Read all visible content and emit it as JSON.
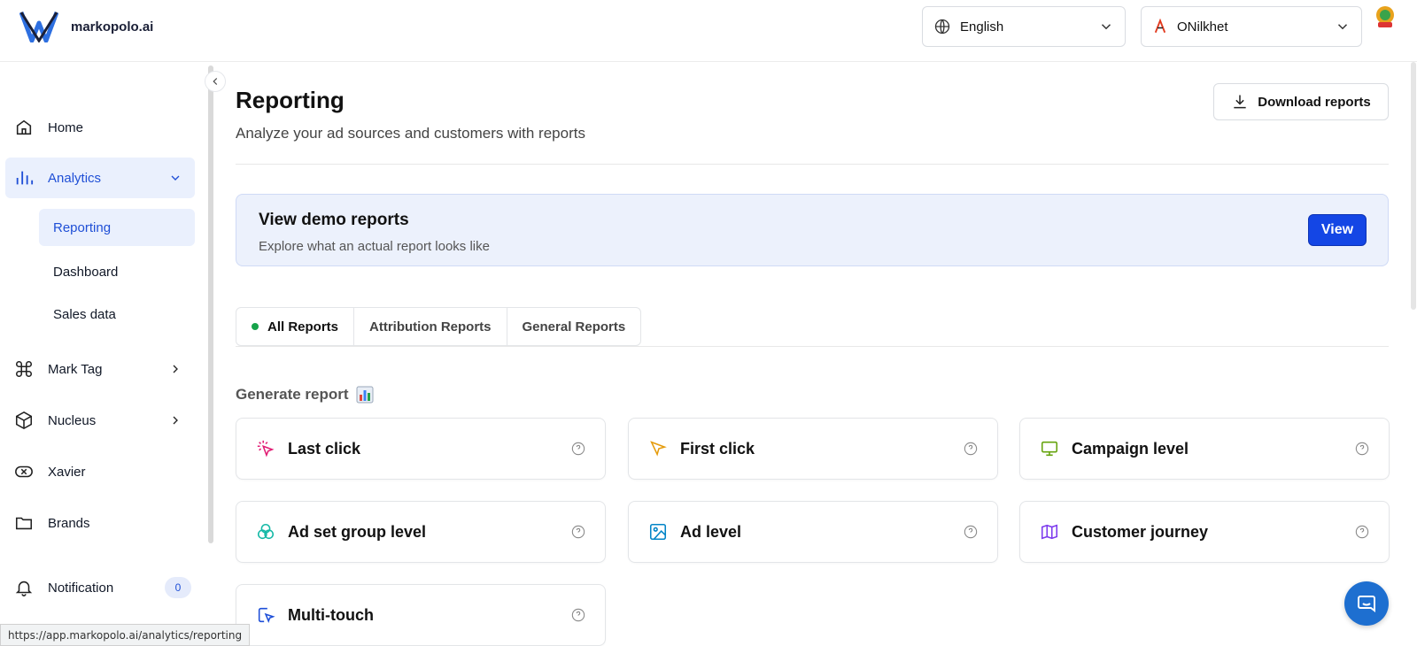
{
  "header": {
    "brand": "markopolo.ai",
    "language_select": "English",
    "account_select": "ONilkhet"
  },
  "sidebar": {
    "items": [
      {
        "label": "Home",
        "icon": "home-icon"
      },
      {
        "label": "Analytics",
        "icon": "bar-chart-icon"
      },
      {
        "label": "Mark Tag",
        "icon": "command-icon"
      },
      {
        "label": "Nucleus",
        "icon": "cube-icon"
      },
      {
        "label": "Xavier",
        "icon": "xavier-icon"
      },
      {
        "label": "Brands",
        "icon": "folder-icon"
      },
      {
        "label": "Notification",
        "icon": "bell-icon",
        "badge": "0"
      }
    ],
    "analytics_sub": [
      "Reporting",
      "Dashboard",
      "Sales data"
    ]
  },
  "main": {
    "title": "Reporting",
    "subtitle": "Analyze your ad sources and customers with reports",
    "download_label": "Download reports",
    "demo": {
      "title": "View demo reports",
      "subtitle": "Explore what an actual report looks like",
      "button": "View"
    },
    "tabs": [
      "All Reports",
      "Attribution Reports",
      "General Reports"
    ],
    "generate_label": "Generate report",
    "reports": [
      {
        "title": "Last click",
        "icon": "cursor-click-icon",
        "color": "#e11d74"
      },
      {
        "title": "First click",
        "icon": "pointer-icon",
        "color": "#e59b0b"
      },
      {
        "title": "Campaign level",
        "icon": "monitor-icon",
        "color": "#65a30d"
      },
      {
        "title": "Ad set group level",
        "icon": "circles-icon",
        "color": "#14b8a6"
      },
      {
        "title": "Ad level",
        "icon": "image-icon",
        "color": "#0284c7"
      },
      {
        "title": "Customer journey",
        "icon": "map-icon",
        "color": "#7c3aed"
      },
      {
        "title": "Multi-touch",
        "icon": "touch-icon",
        "color": "#1d4ed8"
      }
    ]
  },
  "status_url": "https://app.markopolo.ai/analytics/reporting",
  "colors": {
    "accent": "#1f4fd6",
    "primary_button": "#1446e5",
    "active_bg": "#eaf0fd"
  }
}
